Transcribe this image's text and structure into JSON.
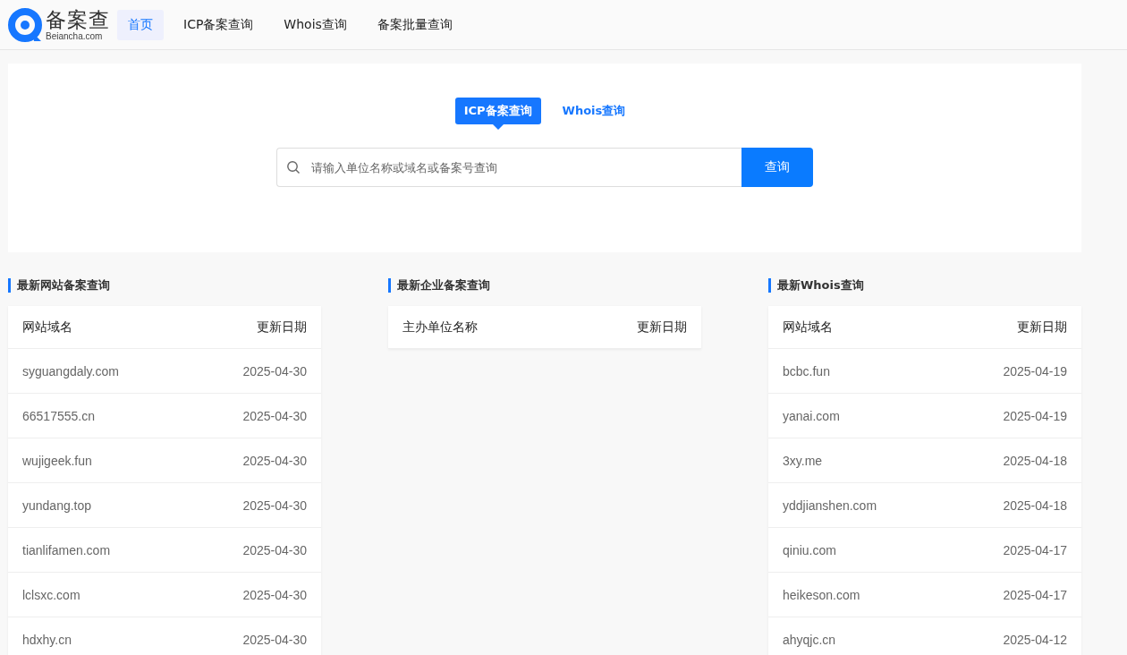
{
  "logo": {
    "name": "备案查",
    "domain": "Beiancha.com"
  },
  "nav": [
    {
      "label": "首页",
      "selected": true
    },
    {
      "label": "ICP备案查询",
      "selected": false
    },
    {
      "label": "Whois查询",
      "selected": false
    },
    {
      "label": "备案批量查询",
      "selected": false
    }
  ],
  "search_tabs": [
    {
      "label": "ICP备案查询",
      "selected": true
    },
    {
      "label": "Whois查询",
      "selected": false
    }
  ],
  "search": {
    "placeholder": "请输入单位名称或域名或备案号查询",
    "button": "查询"
  },
  "sections": [
    {
      "title": "最新网站备案查询",
      "columns": [
        "网站域名",
        "更新日期"
      ],
      "rows": [
        [
          "syguangdaly.com",
          "2025-04-30"
        ],
        [
          "66517555.cn",
          "2025-04-30"
        ],
        [
          "wujigeek.fun",
          "2025-04-30"
        ],
        [
          "yundang.top",
          "2025-04-30"
        ],
        [
          "tianlifamen.com",
          "2025-04-30"
        ],
        [
          "lclsxc.com",
          "2025-04-30"
        ],
        [
          "hdxhy.cn",
          "2025-04-30"
        ]
      ]
    },
    {
      "title": "最新企业备案查询",
      "columns": [
        "主办单位名称",
        "更新日期"
      ]
    },
    {
      "title": "最新Whois查询",
      "columns": [
        "网站域名",
        "更新日期"
      ],
      "rows": [
        [
          "bcbc.fun",
          "2025-04-19"
        ],
        [
          "yanai.com",
          "2025-04-19"
        ],
        [
          "3xy.me",
          "2025-04-18"
        ],
        [
          "yddjianshen.com",
          "2025-04-18"
        ],
        [
          "qiniu.com",
          "2025-04-17"
        ],
        [
          "heikeson.com",
          "2025-04-17"
        ],
        [
          "ahyqjc.cn",
          "2025-04-12"
        ]
      ]
    }
  ]
}
